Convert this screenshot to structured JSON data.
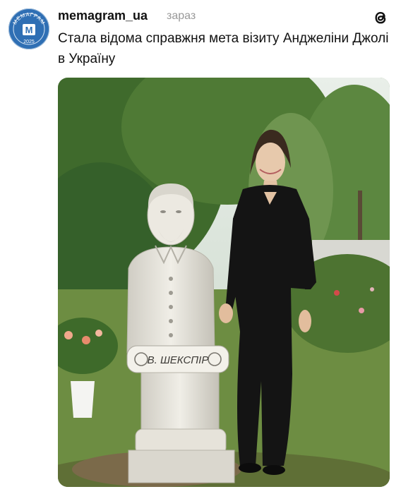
{
  "post": {
    "username": "memagram_ua",
    "time": "зараз",
    "text": "Стала відома справжня мета візиту Анджеліни Джолі в Україну"
  },
  "avatar": {
    "brand_text": "МЕМАГРАМ",
    "year": "2025",
    "letter": "М",
    "color": "#2f6fb4"
  },
  "photo": {
    "plaque_text": "В. ШЕКСПІР"
  },
  "icons": {
    "app": "threads-icon"
  }
}
